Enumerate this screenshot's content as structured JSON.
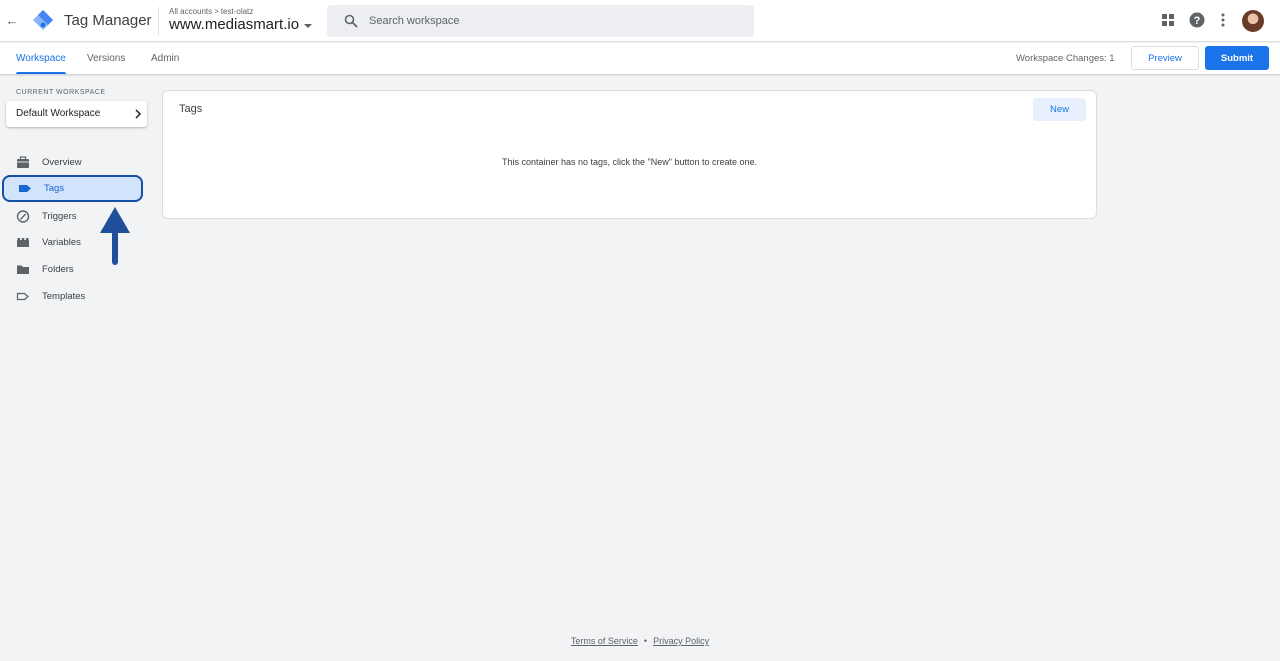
{
  "header": {
    "app_title": "Tag Manager",
    "breadcrumb": {
      "account": "All accounts",
      "container": "test-olatz"
    },
    "container_name": "www.mediasmart.io",
    "search_placeholder": "Search workspace"
  },
  "tabs": [
    {
      "label": "Workspace",
      "active": true
    },
    {
      "label": "Versions",
      "active": false
    },
    {
      "label": "Admin",
      "active": false
    }
  ],
  "toolbar": {
    "workspace_changes": "Workspace Changes: 1",
    "preview_label": "Preview",
    "submit_label": "Submit"
  },
  "sidebar": {
    "current_workspace_label": "CURRENT WORKSPACE",
    "workspace_name": "Default Workspace",
    "items": [
      {
        "label": "Overview",
        "icon": "briefcase-icon",
        "active": false
      },
      {
        "label": "Tags",
        "icon": "tag-icon",
        "active": true
      },
      {
        "label": "Triggers",
        "icon": "trigger-icon",
        "active": false
      },
      {
        "label": "Variables",
        "icon": "variables-icon",
        "active": false
      },
      {
        "label": "Folders",
        "icon": "folder-icon",
        "active": false
      },
      {
        "label": "Templates",
        "icon": "template-icon",
        "active": false
      }
    ]
  },
  "main": {
    "card_title": "Tags",
    "new_label": "New",
    "empty_message": "This container has no tags, click the \"New\" button to create one."
  },
  "footer": {
    "terms": "Terms of Service",
    "separator": "•",
    "privacy": "Privacy Policy"
  },
  "colors": {
    "accent": "#1a73e8",
    "active_nav_bg": "#d2e3fc",
    "annotation": "#174ea6",
    "page_bg": "#f1f3f4"
  }
}
